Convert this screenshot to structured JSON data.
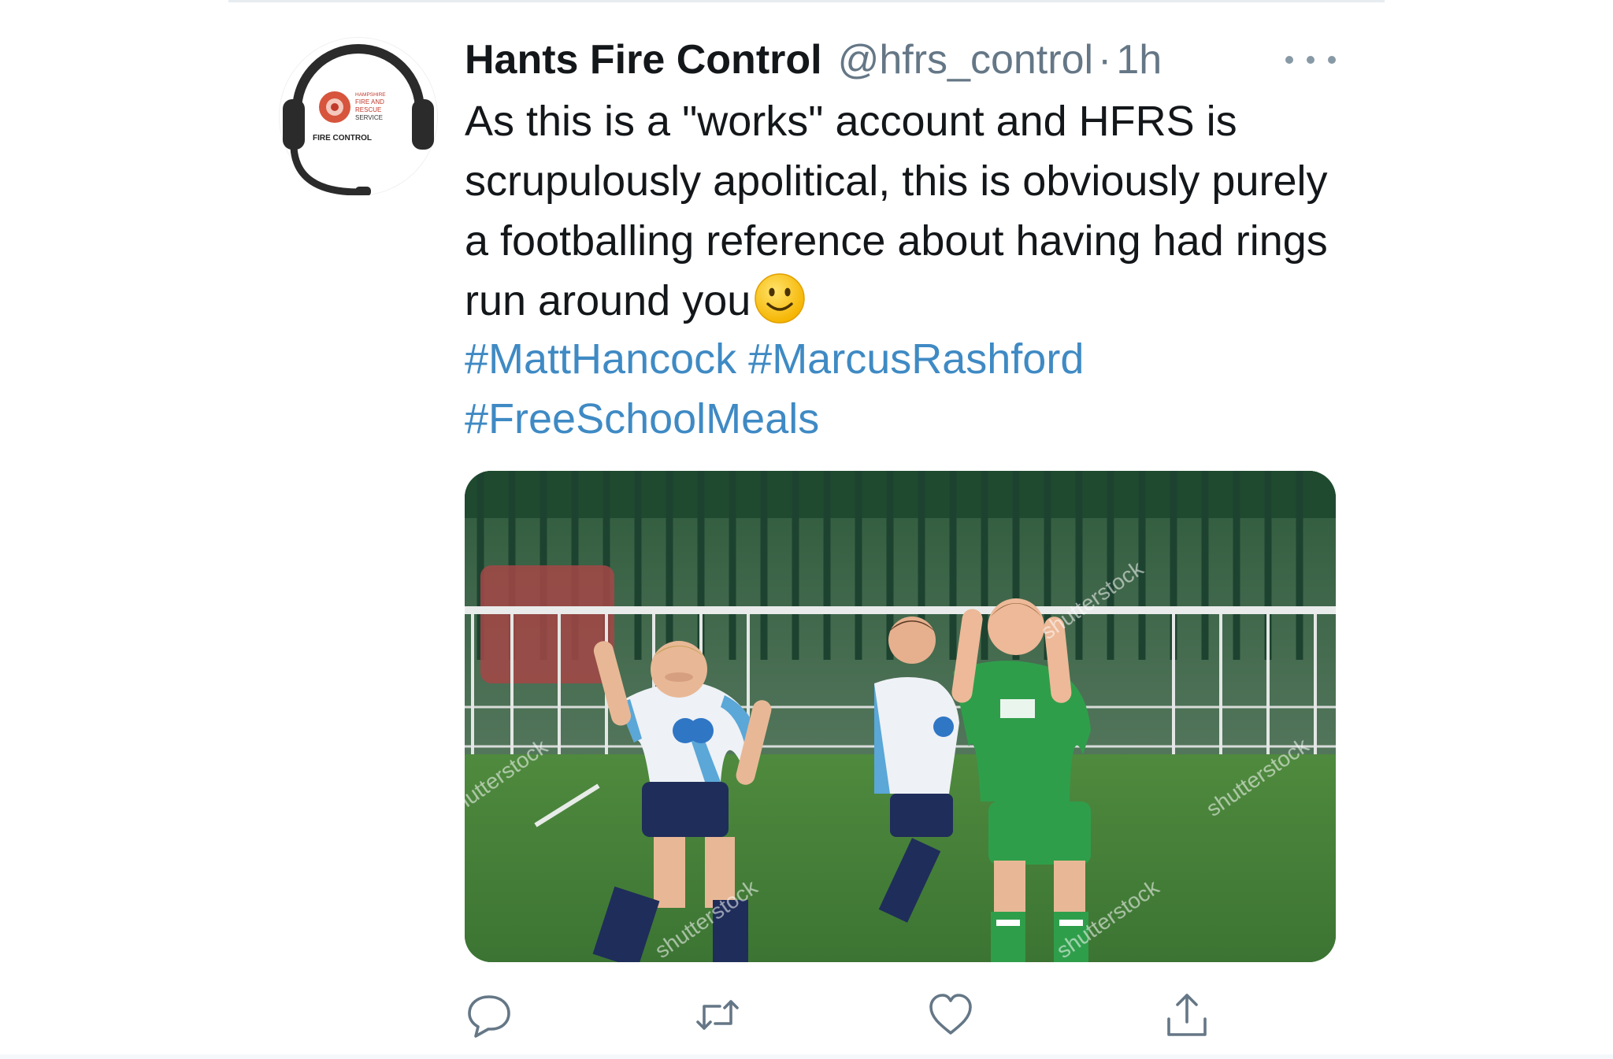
{
  "tweet": {
    "author": {
      "display_name": "Hants Fire Control",
      "handle": "@hfrs_control",
      "avatar": {
        "icon": "headset-logo-icon",
        "logo_text": [
          "HAMPSHIRE",
          "FIRE AND",
          "RESCUE",
          "SERVICE"
        ],
        "caption": "FIRE CONTROL"
      }
    },
    "separator": "·",
    "time": "1h",
    "text": "As this is a \"works\" account and HFRS is scrupulously apolitical, this is obviously purely a footballing reference about having had rings run around you",
    "emoji": "slightly-smiling-face-icon",
    "hashtags": [
      "#MattHancock",
      "#MarcusRashford",
      "#FreeSchoolMeals"
    ],
    "media": {
      "description_icon": "football-photo",
      "watermark": "shutterstock"
    },
    "actions": [
      {
        "name": "reply",
        "icon": "reply-icon"
      },
      {
        "name": "retweet",
        "icon": "retweet-icon"
      },
      {
        "name": "like",
        "icon": "heart-icon"
      },
      {
        "name": "share",
        "icon": "share-icon"
      }
    ],
    "colors": {
      "hashtag": "#3f8ac4",
      "meta": "#657786",
      "text": "#14171a"
    }
  }
}
